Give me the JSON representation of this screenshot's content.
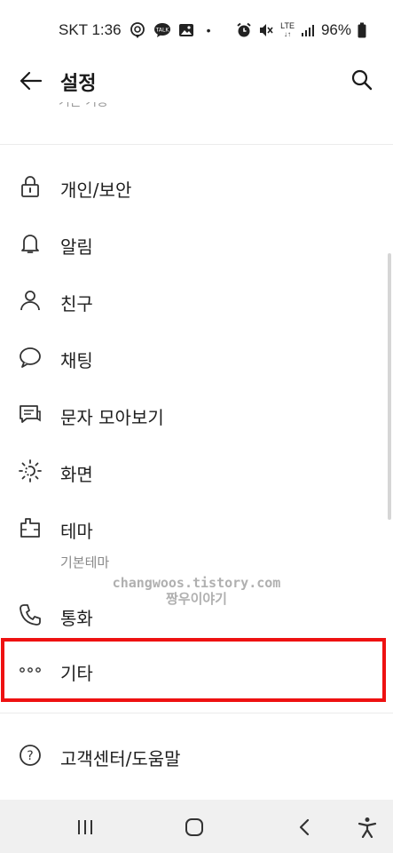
{
  "status_bar": {
    "carrier_time": "SKT 1:36",
    "dot": "•",
    "network": "LTE",
    "battery": "96%",
    "left_icons": [
      "location-pin-icon",
      "talk-bubble-icon",
      "image-icon"
    ],
    "right_icons": [
      "alarm-icon",
      "mute-icon",
      "lte-icon",
      "signal-icon",
      "battery-icon"
    ]
  },
  "header": {
    "title": "설정",
    "back_icon": "arrow-left-icon",
    "search_icon": "search-icon"
  },
  "clipped_text": "기본 기능",
  "menu": {
    "items": [
      {
        "label": "개인/보안",
        "icon": "lock-icon"
      },
      {
        "label": "알림",
        "icon": "bell-icon"
      },
      {
        "label": "친구",
        "icon": "person-icon"
      },
      {
        "label": "채팅",
        "icon": "chat-bubble-icon"
      },
      {
        "label": "문자 모아보기",
        "icon": "messages-icon"
      },
      {
        "label": "화면",
        "icon": "brightness-icon"
      },
      {
        "label": "테마",
        "sub": "기본테마",
        "icon": "theme-icon"
      },
      {
        "label": "통화",
        "icon": "phone-icon"
      },
      {
        "label": "기타",
        "icon": "more-dots-icon"
      },
      {
        "label": "고객센터/도움말",
        "icon": "help-circle-icon"
      }
    ]
  },
  "watermark": {
    "line1": "changwoos.tistory.com",
    "line2": "짱우이야기"
  },
  "nav_bar": {
    "icons": [
      "recent-apps-icon",
      "home-icon",
      "back-icon",
      "accessibility-icon"
    ]
  },
  "colors": {
    "highlight": "#ee1111",
    "divider": "#ebebeb",
    "nav_bg": "#f0f0f0"
  }
}
